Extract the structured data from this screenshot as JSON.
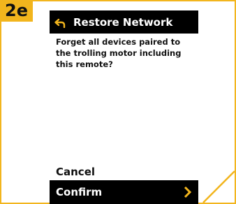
{
  "step_badge": "2e",
  "header": {
    "title": "Restore Network",
    "back_icon": "back-arrow-icon"
  },
  "message": "Forget all devices paired to the trolling motor including this remote?",
  "actions": {
    "cancel_label": "Cancel",
    "confirm_label": "Confirm",
    "confirm_icon": "chevron-right-icon"
  },
  "colors": {
    "accent": "#f2b51d",
    "bar_background": "#000000",
    "bar_text": "#ffffff"
  }
}
